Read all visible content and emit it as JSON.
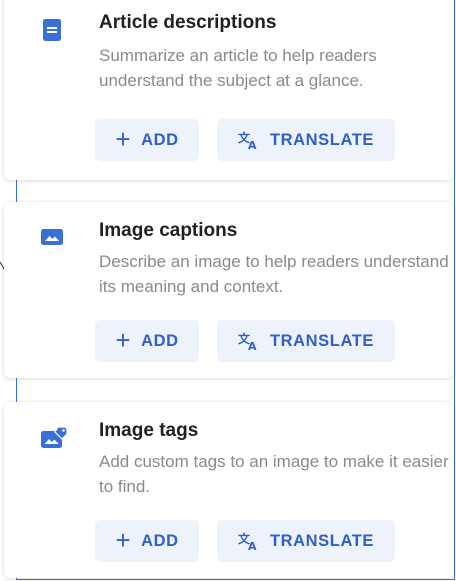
{
  "cards": [
    {
      "title": "Article descriptions",
      "description": "Summarize an article to help readers understand the subject at a glance.",
      "icon": "article-icon",
      "add_label": "ADD",
      "translate_label": "TRANSLATE"
    },
    {
      "title": "Image captions",
      "description": "Describe an image to help readers understand its meaning and context.",
      "icon": "image-icon",
      "add_label": "ADD",
      "translate_label": "TRANSLATE"
    },
    {
      "title": "Image tags",
      "description": "Add custom tags to an image to make it easier to find.",
      "icon": "image-tag-icon",
      "add_label": "ADD",
      "translate_label": "TRANSLATE"
    }
  ],
  "colors": {
    "accent": "#2f60c8",
    "icon": "#3b6fd8",
    "button_bg": "#eef3fb",
    "title": "#202124",
    "description": "#8a8a8a",
    "frame": "#3b6fd8"
  }
}
